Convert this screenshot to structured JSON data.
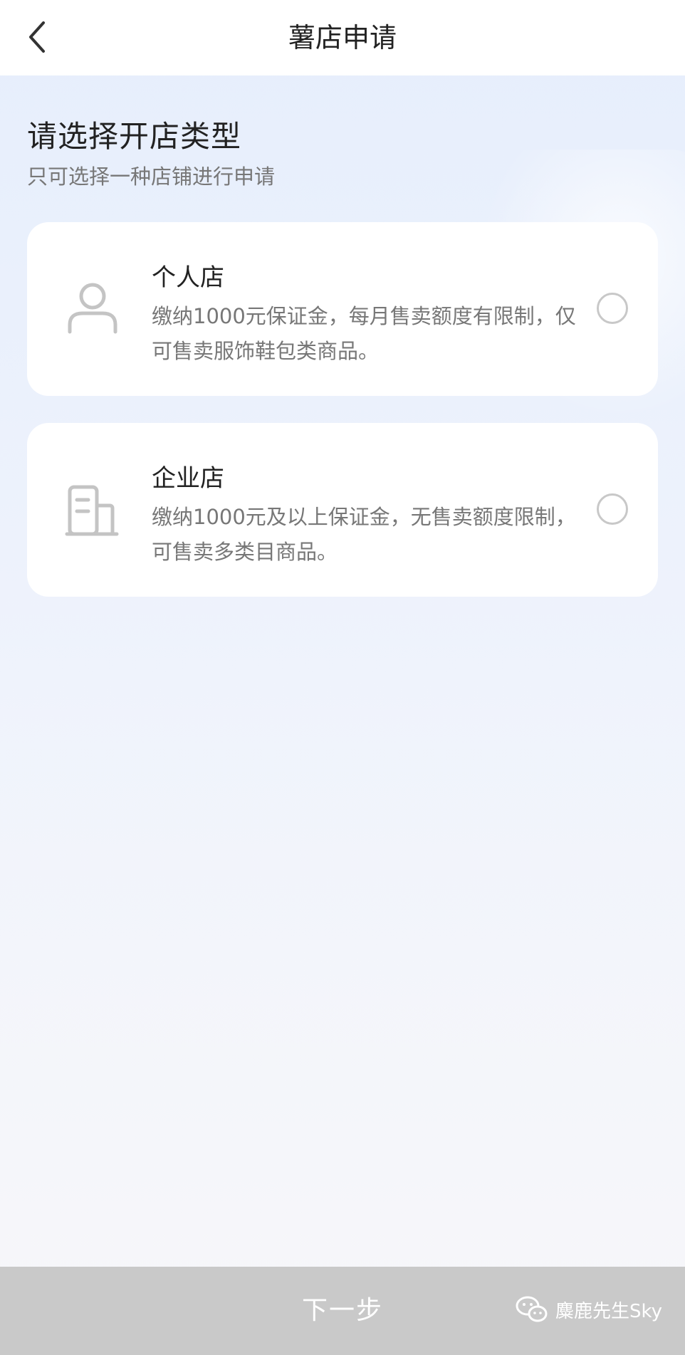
{
  "nav": {
    "back_icon": "chevron-left-icon",
    "title": "薯店申请"
  },
  "intro": {
    "heading": "请选择开店类型",
    "subheading": "只可选择一种店铺进行申请"
  },
  "options": [
    {
      "icon": "person-icon",
      "title": "个人店",
      "description": "缴纳1000元保证金，每月售卖额度有限制，仅可售卖服饰鞋包类商品。",
      "selected": false
    },
    {
      "icon": "building-icon",
      "title": "企业店",
      "description": "缴纳1000元及以上保证金，无售卖额度限制，可售卖多类目商品。",
      "selected": false
    }
  ],
  "footer": {
    "next_label": "下一步",
    "watermark_icon": "wechat-icon",
    "watermark_text": "麋鹿先生Sky"
  },
  "colors": {
    "nav_background": "#ffffff",
    "card_background": "#ffffff",
    "radio_border": "#c8c8c8",
    "icon_gray": "#c4c4c4",
    "button_disabled": "#c9c9c9"
  }
}
